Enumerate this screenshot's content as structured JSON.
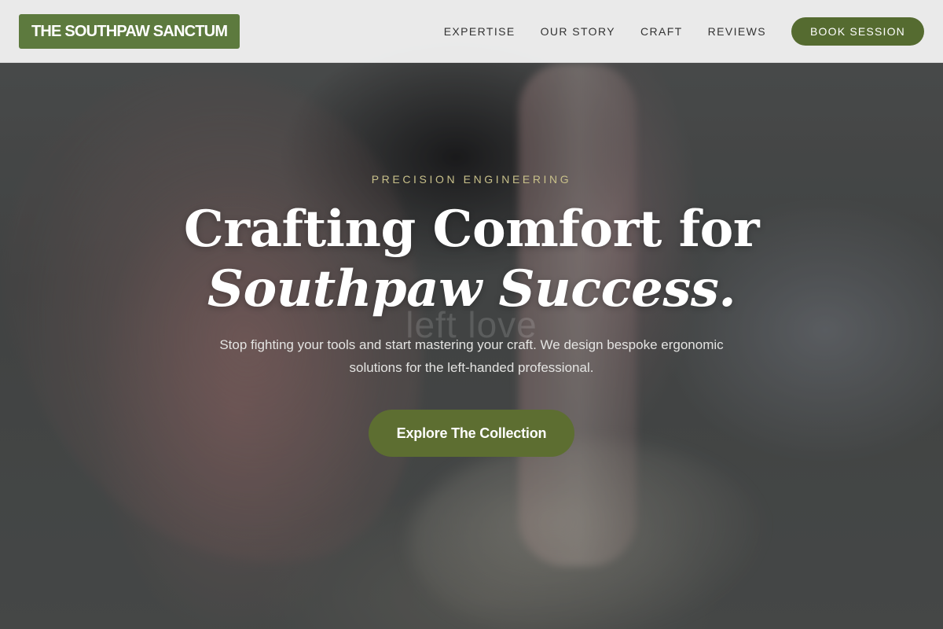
{
  "header": {
    "logo_text": "THE SOUTHPAW SANCTUM",
    "nav": [
      {
        "label": "EXPERTISE"
      },
      {
        "label": "OUR STORY"
      },
      {
        "label": "CRAFT"
      },
      {
        "label": "REVIEWS"
      }
    ],
    "cta_label": "BOOK SESSION"
  },
  "hero": {
    "eyebrow": "PRECISION ENGINEERING",
    "headline_line1": "Crafting Comfort for",
    "headline_line2": "Southpaw Success.",
    "watermark": "left love",
    "subtext": "Stop fighting your tools and start mastering your craft. We design bespoke ergonomic solutions for the left-handed professional.",
    "cta_label": "Explore The Collection"
  },
  "colors": {
    "brand_green": "#5d7a3e",
    "button_green": "#5d6e31",
    "eyebrow_gold": "#c8c08a",
    "header_bg": "#f0f0f0"
  }
}
